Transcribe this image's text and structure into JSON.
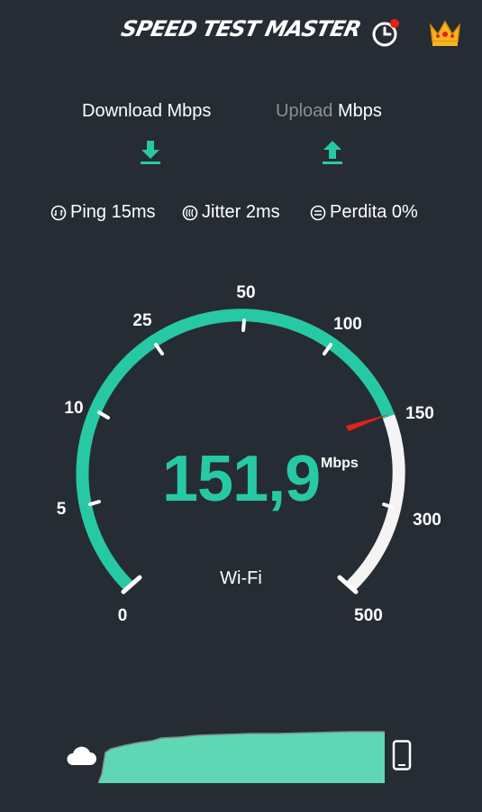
{
  "header": {
    "brand": "SPEED TEST MASTER"
  },
  "tabs": {
    "download_label": "Download",
    "download_unit": "Mbps",
    "upload_label": "Upload",
    "upload_unit": "Mbps"
  },
  "stats": {
    "ping": "Ping 15ms",
    "jitter": "Jitter 2ms",
    "loss": "Perdita 0%"
  },
  "gauge": {
    "scale_labels": [
      "0",
      "5",
      "10",
      "25",
      "50",
      "100",
      "150",
      "300",
      "500"
    ],
    "current_value": 151.9,
    "value_text": "151,9",
    "unit": "Mbps",
    "connection": "Wi-Fi"
  },
  "colors": {
    "accent": "#27c9a4",
    "background": "#262c33",
    "needle": "#e3211b",
    "history_dot": "#e3211b"
  },
  "icons": [
    "history-icon",
    "crown-icon",
    "download-arrow-icon",
    "upload-arrow-icon",
    "ping-icon",
    "jitter-icon",
    "loss-icon",
    "cloud-icon",
    "phone-icon"
  ]
}
